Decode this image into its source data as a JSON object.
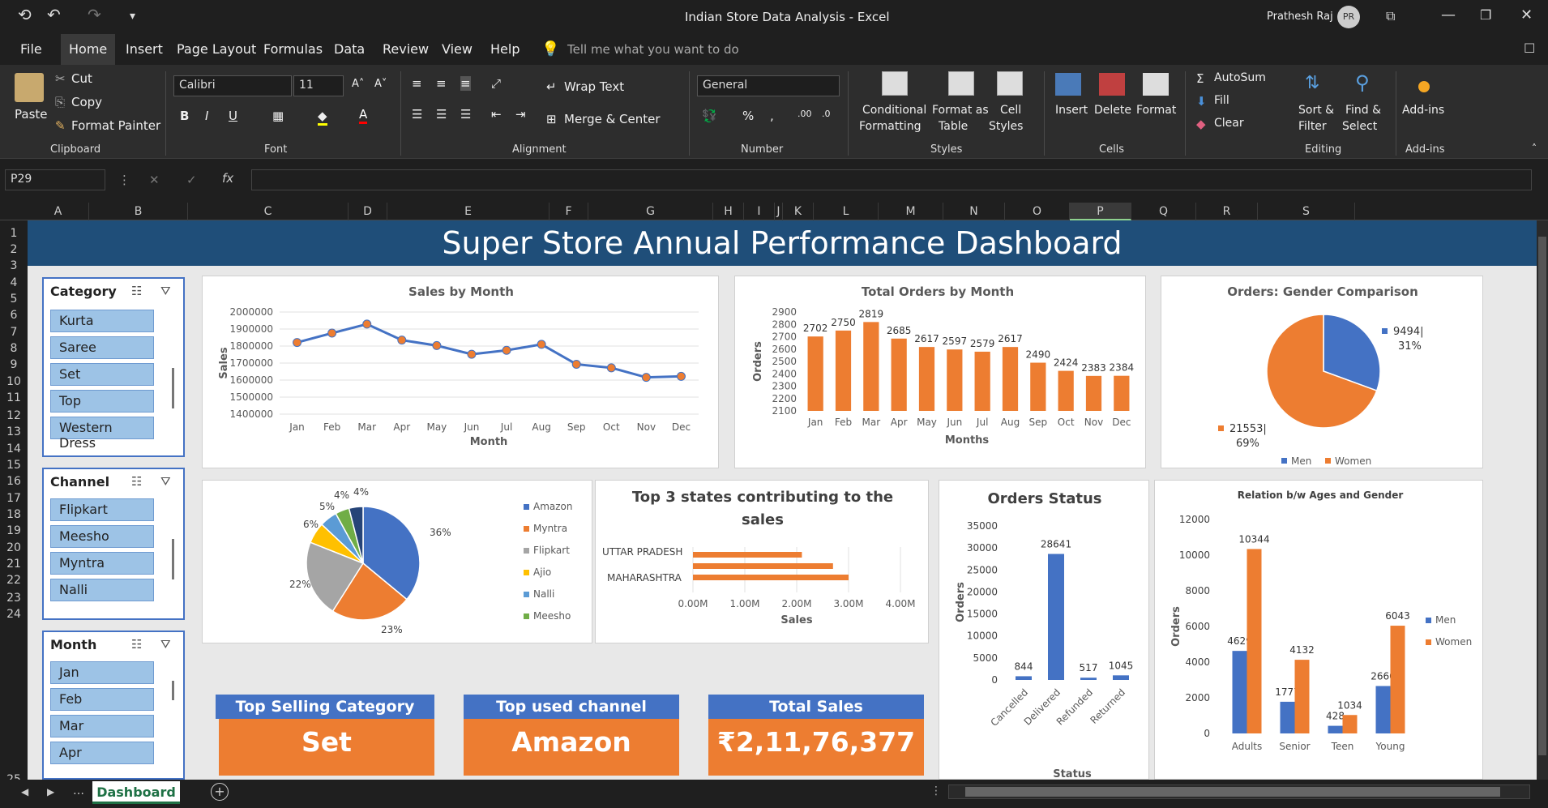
{
  "window": {
    "title": "Indian Store Data Analysis  -  Excel",
    "user": "Prathesh Raj",
    "initials": "PR"
  },
  "menu": [
    "File",
    "Home",
    "Insert",
    "Page Layout",
    "Formulas",
    "Data",
    "Review",
    "View",
    "Help"
  ],
  "tellme": "Tell me what you want to do",
  "ribbon": {
    "paste": "Paste",
    "cut": "Cut",
    "copy": "Copy",
    "format_painter": "Format Painter",
    "clipboard": "Clipboard",
    "font_name": "Calibri",
    "font_size": "11",
    "font": "Font",
    "wrap_text": "Wrap Text",
    "merge_center": "Merge & Center",
    "alignment": "Alignment",
    "number_format": "General",
    "number": "Number",
    "cond_fmt_1": "Conditional",
    "cond_fmt_2": "Formatting",
    "fmt_table_1": "Format as",
    "fmt_table_2": "Table",
    "cell_styles_1": "Cell",
    "cell_styles_2": "Styles",
    "styles": "Styles",
    "insert": "Insert",
    "delete": "Delete",
    "format": "Format",
    "cells": "Cells",
    "autosum": "AutoSum",
    "fill": "Fill",
    "clear": "Clear",
    "sort_1": "Sort &",
    "sort_2": "Filter",
    "find_1": "Find &",
    "find_2": "Select",
    "editing": "Editing",
    "addins": "Add-ins",
    "addins_group": "Add-ins"
  },
  "formula_bar": {
    "name_box": "P29",
    "fx": "fx",
    "value": ""
  },
  "columns": [
    "A",
    "B",
    "C",
    "D",
    "E",
    "F",
    "G",
    "H",
    "I",
    "J",
    "K",
    "L",
    "M",
    "N",
    "O",
    "P",
    "Q",
    "R",
    "S"
  ],
  "rows": [
    "1",
    "2",
    "3",
    "4",
    "5",
    "6",
    "7",
    "8",
    "9",
    "10",
    "11",
    "12",
    "13",
    "14",
    "15",
    "16",
    "17",
    "18",
    "19",
    "20",
    "21",
    "22",
    "23",
    "24",
    "25"
  ],
  "dashboard_title": "Super Store Annual Performance Dashboard",
  "slicers": [
    {
      "header": "Category",
      "items": [
        "Kurta",
        "Saree",
        "Set",
        "Top",
        "Western Dress"
      ]
    },
    {
      "header": "Channel",
      "items": [
        "Flipkart",
        "Meesho",
        "Myntra",
        "Nalli"
      ]
    },
    {
      "header": "Month",
      "items": [
        "Jan",
        "Feb",
        "Mar",
        "Apr"
      ]
    }
  ],
  "kpis": [
    {
      "label": "Top Selling Category",
      "value": "Set"
    },
    {
      "label": "Top used channel",
      "value": "Amazon"
    },
    {
      "label": "Total Sales",
      "value": "₹2,11,76,377"
    }
  ],
  "sheet_tab": "Dashboard",
  "colors": {
    "blue": "#4472c4",
    "orange": "#ed7d31",
    "gray": "#a5a5a5",
    "yellow": "#ffc000",
    "lightblue": "#5b9bd5",
    "green": "#70ad47",
    "navy": "#264478",
    "banner": "#1f4e79"
  },
  "chart_data": [
    {
      "type": "line",
      "title": "Sales by Month",
      "xlabel": "Month",
      "ylabel": "Sales",
      "categories": [
        "Jan",
        "Feb",
        "Mar",
        "Apr",
        "May",
        "Jun",
        "Jul",
        "Aug",
        "Sep",
        "Oct",
        "Nov",
        "Dec"
      ],
      "values": [
        1821000,
        1876000,
        1929000,
        1835000,
        1803000,
        1752000,
        1775000,
        1810000,
        1693000,
        1672000,
        1616000,
        1622000
      ],
      "yticks": [
        "2000000",
        "1900000",
        "1800000",
        "1700000",
        "1600000",
        "1500000",
        "1400000"
      ],
      "ylim": [
        1400000,
        2000000
      ]
    },
    {
      "type": "bar",
      "title": "Total Orders by Month",
      "xlabel": "Months",
      "ylabel": "Orders",
      "categories": [
        "Jan",
        "Feb",
        "Mar",
        "Apr",
        "May",
        "Jun",
        "Jul",
        "Aug",
        "Sep",
        "Oct",
        "Nov",
        "Dec"
      ],
      "values": [
        2702,
        2750,
        2819,
        2685,
        2617,
        2597,
        2579,
        2617,
        2490,
        2424,
        2383,
        2384
      ],
      "yticks": [
        "2900",
        "2800",
        "2700",
        "2600",
        "2500",
        "2400",
        "2300",
        "2200",
        "2100"
      ],
      "ylim": [
        2100,
        2900
      ]
    },
    {
      "type": "pie",
      "title": "Orders: Gender Comparison",
      "slices": [
        {
          "name": "Men",
          "value": 9494,
          "label_1": "9494|",
          "label_2": "31%"
        },
        {
          "name": "Women",
          "value": 21553,
          "label_1": "21553|",
          "label_2": "69%"
        }
      ]
    },
    {
      "type": "pie",
      "title": "",
      "slices": [
        {
          "name": "Amazon",
          "pct": "36%",
          "value": 36
        },
        {
          "name": "Myntra",
          "pct": "23%",
          "value": 23
        },
        {
          "name": "Flipkart",
          "pct": "22%",
          "value": 22
        },
        {
          "name": "Ajio",
          "pct": "6%",
          "value": 6
        },
        {
          "name": "Nalli",
          "pct": "5%",
          "value": 5
        },
        {
          "name": "Meesho",
          "pct": "4%",
          "value": 4
        },
        {
          "name": "",
          "pct": "4%",
          "value": 4
        }
      ]
    },
    {
      "type": "bar",
      "title_1": "Top 3 states contributing to the",
      "title_2": "sales",
      "xlabel": "Sales",
      "categories": [
        "UTTAR PRADESH",
        "MAHARASHTRA"
      ],
      "values": [
        2.1,
        2.7,
        3.0
      ],
      "xticks": [
        "0.00M",
        "1.00M",
        "2.00M",
        "3.00M",
        "4.00M"
      ],
      "xlim": [
        0,
        4
      ]
    },
    {
      "type": "bar",
      "title": "Orders Status",
      "xlabel": "Status",
      "ylabel": "Orders",
      "categories": [
        "Cancelled",
        "Delivered",
        "Refunded",
        "Returned"
      ],
      "values": [
        844,
        28641,
        517,
        1045
      ],
      "yticks": [
        "35000",
        "30000",
        "25000",
        "20000",
        "15000",
        "10000",
        "5000",
        "0"
      ],
      "ylim": [
        0,
        35000
      ]
    },
    {
      "type": "bar",
      "title": "Relation b/w Ages and Gender",
      "ylabel": "Orders",
      "categories": [
        "Adults",
        "Senior",
        "Teen",
        "Young"
      ],
      "series": [
        {
          "name": "Men",
          "values": [
            4629,
            1777,
            428,
            2660
          ]
        },
        {
          "name": "Women",
          "values": [
            10344,
            4132,
            1034,
            6043
          ]
        }
      ],
      "yticks": [
        "12000",
        "10000",
        "8000",
        "6000",
        "4000",
        "2000",
        "0"
      ],
      "ylim": [
        0,
        12000
      ]
    }
  ]
}
